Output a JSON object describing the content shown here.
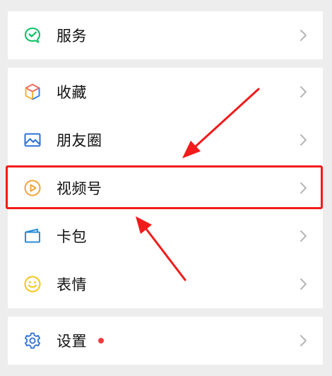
{
  "menu": {
    "service": {
      "label": "服务",
      "icon": "wechat-pay-icon",
      "color": "#07c160"
    },
    "favorites": {
      "label": "收藏",
      "icon": "cube-icon"
    },
    "moments": {
      "label": "朋友圈",
      "icon": "image-icon",
      "color": "#2a6fdb"
    },
    "channels": {
      "label": "视频号",
      "icon": "play-circle-icon",
      "color": "#f0a43a"
    },
    "cards": {
      "label": "卡包",
      "icon": "wallet-icon",
      "color": "#2a8cd8"
    },
    "stickers": {
      "label": "表情",
      "icon": "smile-icon",
      "color": "#f5c518"
    },
    "settings": {
      "label": "设置",
      "icon": "gear-icon",
      "color": "#2a6fdb",
      "has_badge": true,
      "badge_color": "#f23b3b"
    }
  },
  "annotation": {
    "highlight_color": "#f21b1b",
    "arrows": 2
  }
}
